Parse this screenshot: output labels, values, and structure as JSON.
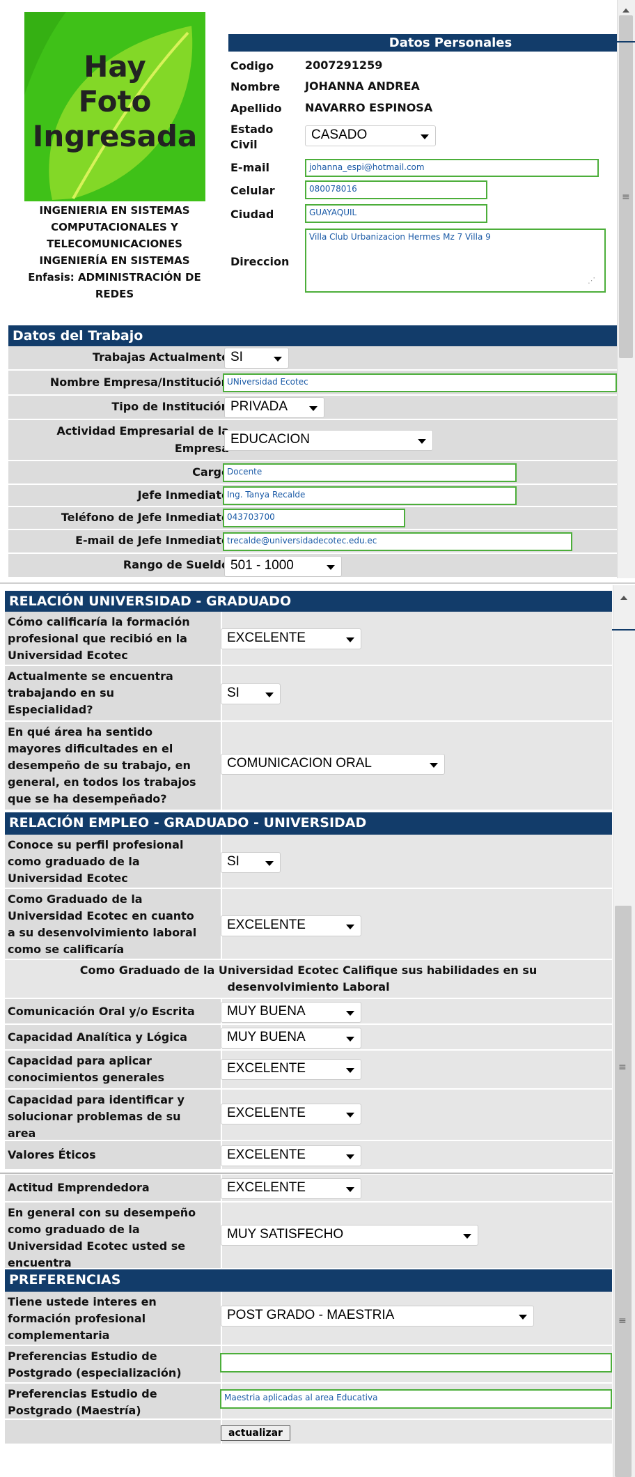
{
  "photo": {
    "line1": "Hay",
    "line2": "Foto",
    "line3": "Ingresada"
  },
  "career": {
    "line1": "INGENIERIA EN SISTEMAS",
    "line2": "COMPUTACIONALES Y",
    "line3": "TELECOMUNICACIONES",
    "line4": "INGENIERÍA EN SISTEMAS",
    "line5": "Enfasis: ADMINISTRACIÓN DE",
    "line6": "REDES"
  },
  "personal": {
    "header": "Datos Personales",
    "codigo_label": "Codigo",
    "codigo": "2007291259",
    "nombre_label": "Nombre",
    "nombre": "JOHANNA ANDREA",
    "apellido_label": "Apellido",
    "apellido": "NAVARRO ESPINOSA",
    "estado_label_1": "Estado",
    "estado_label_2": "Civil",
    "estado": "CASADO",
    "email_label": "E-mail",
    "email": "johanna_espi@hotmail.com",
    "celular_label": "Celular",
    "celular": "080078016",
    "ciudad_label": "Ciudad",
    "ciudad": "GUAYAQUIL",
    "direccion_label": "Direccion",
    "direccion": "Villa Club Urbanizacion Hermes Mz 7 Villa 9"
  },
  "work": {
    "header": "Datos del Trabajo",
    "actual_label": "Trabajas Actualmente",
    "actual": "SI",
    "empresa_label": "Nombre Empresa/Institución",
    "empresa": "UNiversidad Ecotec",
    "tipo_label": "Tipo de Institución",
    "tipo": "PRIVADA",
    "actividad_label_1": "Actividad Empresarial de la",
    "actividad_label_2": "Empresa",
    "actividad": "EDUCACION",
    "cargo_label": "Cargo",
    "cargo": "Docente",
    "jefe_label": "Jefe Inmediato",
    "jefe": "Ing. Tanya Recalde",
    "telefono_label": "Teléfono de Jefe Inmediato",
    "telefono": "043703700",
    "jefe_email_label": "E-mail de Jefe Inmediato",
    "jefe_email": "trecalde@universidadecotec.edu.ec",
    "sueldo_label": "Rango de Sueldo",
    "sueldo": "501 - 1000"
  },
  "rel_univ": {
    "header": "RELACIÓN UNIVERSIDAD - GRADUADO",
    "q1_l1": "Cómo calificaría la formación",
    "q1_l2": "profesional que recibió en la",
    "q1_l3": "Universidad Ecotec",
    "q1": "EXCELENTE",
    "q2_l1": "Actualmente se encuentra",
    "q2_l2": "trabajando en su",
    "q2_l3": "Especialidad?",
    "q2": "SI",
    "q3_l1": "En qué área ha sentido",
    "q3_l2": "mayores dificultades en el",
    "q3_l3": "desempeño de su trabajo, en",
    "q3_l4": "general, en todos los trabajos",
    "q3_l5": "que se ha desempeñado?",
    "q3": "COMUNICACION ORAL"
  },
  "rel_empleo": {
    "header": "RELACIÓN EMPLEO - GRADUADO - UNIVERSIDAD",
    "q1_l1": "Conoce su perfil profesional",
    "q1_l2": "como graduado de la",
    "q1_l3": "Universidad Ecotec",
    "q1": "SI",
    "q2_l1": "Como Graduado de la",
    "q2_l2": "Universidad Ecotec en cuanto",
    "q2_l3": "a su desenvolvimiento laboral",
    "q2_l4": "como se calificaría",
    "q2": "EXCELENTE",
    "sub_l1": "Como Graduado de la Universidad Ecotec Califique sus habilidades en su",
    "sub_l2": "desenvolvimiento Laboral",
    "h1_label": "Comunicación Oral y/o Escrita",
    "h1": "MUY BUENA",
    "h2_label": "Capacidad Analítica y Lógica",
    "h2": "MUY BUENA",
    "h3_l1": "Capacidad para aplicar",
    "h3_l2": "conocimientos generales",
    "h3": "EXCELENTE",
    "h4_l1": "Capacidad para identificar y",
    "h4_l2": "solucionar problemas de su",
    "h4_l3": "area",
    "h4": "EXCELENTE",
    "h5_label": "Valores Éticos",
    "h5": "EXCELENTE",
    "h6_label": "Actitud Emprendedora",
    "h6": "EXCELENTE",
    "h7_l1": "En general con su desempeño",
    "h7_l2": "como graduado de la",
    "h7_l3": "Universidad Ecotec usted se",
    "h7_l4": "encuentra",
    "h7": "MUY SATISFECHO"
  },
  "prefs": {
    "header": "PREFERENCIAS",
    "p1_l1": "Tiene ustede interes en",
    "p1_l2": "formación profesional",
    "p1_l3": "complementaria",
    "p1": "POST GRADO - MAESTRIA",
    "p2_l1": "Preferencias Estudio de",
    "p2_l2": "Postgrado (especialización)",
    "p2": "",
    "p3_l1": "Preferencias Estudio de",
    "p3_l2": "Postgrado (Maestría)",
    "p3": "Maestria aplicadas al area Educativa",
    "submit": "actualizar"
  },
  "colors": {
    "header_bg": "#123c6a",
    "photo_green": "#43c41c",
    "input_border": "#4cae3a",
    "row_bg": "#dcdcdc"
  }
}
